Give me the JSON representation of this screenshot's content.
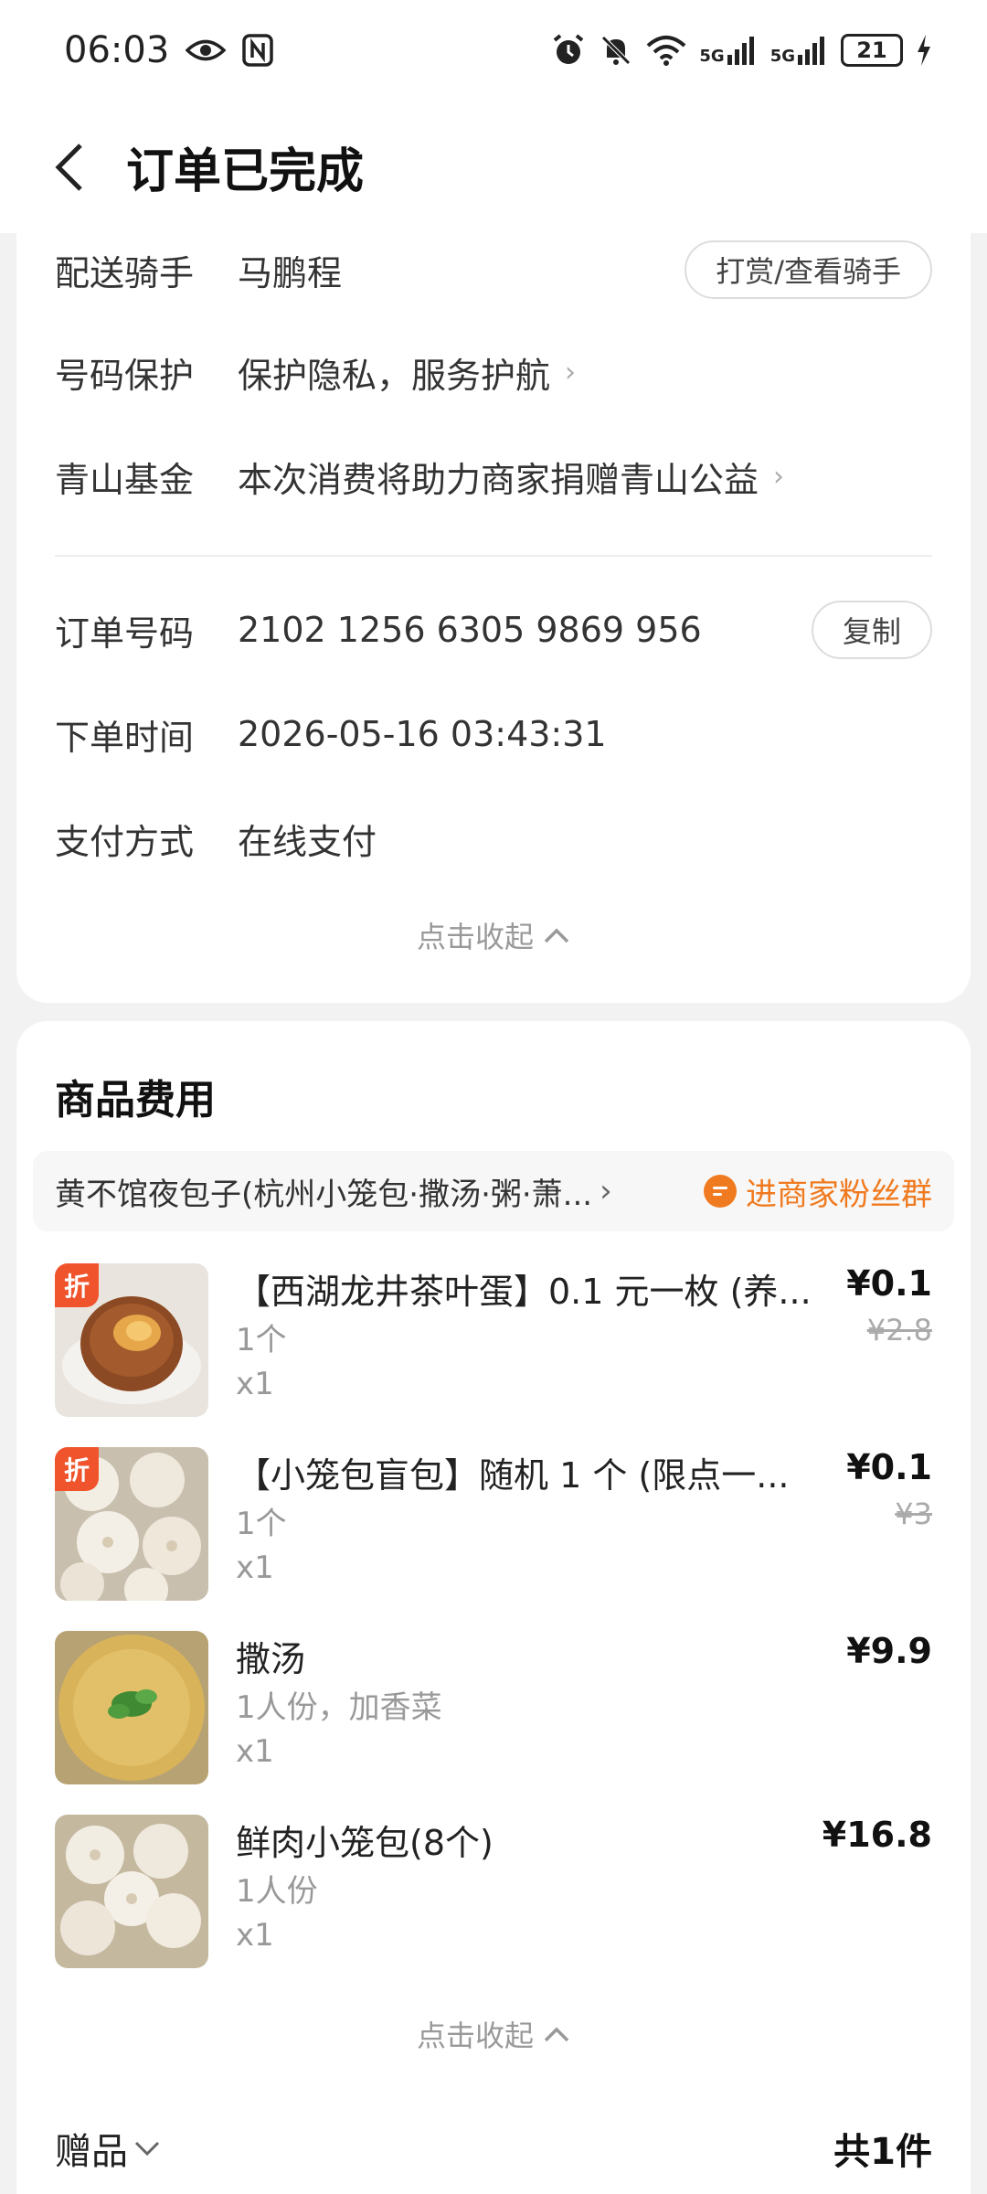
{
  "status_bar": {
    "time": "06:03",
    "battery": "21",
    "icons": [
      "eye-icon",
      "nfc-icon",
      "alarm-icon",
      "mute-icon",
      "wifi-icon",
      "signal-5g-icon",
      "signal-5g-icon",
      "battery-icon",
      "charging-icon"
    ],
    "net1": "5G",
    "net2": "5G"
  },
  "header": {
    "title": "订单已完成"
  },
  "order_info": {
    "rider_label": "配送骑手",
    "rider_name": "马鹏程",
    "rider_button": "打赏/查看骑手",
    "privacy_label": "号码保护",
    "privacy_value": "保护隐私，服务护航",
    "fund_label": "青山基金",
    "fund_value": "本次消费将助力商家捐赠青山公益",
    "order_no_label": "订单号码",
    "order_no": "2102 1256 6305 9869 956",
    "copy_button": "复制",
    "time_label": "下单时间",
    "time_value": "2026-05-16 03:43:31",
    "pay_label": "支付方式",
    "pay_value": "在线支付",
    "collapse": "点击收起"
  },
  "goods": {
    "title": "商品费用",
    "shop_name": "黄不馆夜包子(杭州小笼包·撒汤·粥·萧...",
    "fans_link": "进商家粉丝群",
    "items": [
      {
        "name": "【西湖龙井茶叶蛋】0.1 元一枚 (养...",
        "spec": "1个",
        "qty": "x1",
        "price": "¥0.1",
        "orig": "¥2.8",
        "badge": "折"
      },
      {
        "name": "【小笼包盲包】随机 1 个 (限点一...",
        "spec": "1个",
        "qty": "x1",
        "price": "¥0.1",
        "orig": "¥3",
        "badge": "折"
      },
      {
        "name": "撒汤",
        "spec": "1人份，加香菜",
        "qty": "x1",
        "price": "¥9.9",
        "orig": ""
      },
      {
        "name": "鲜肉小笼包(8个)",
        "spec": "1人份",
        "qty": "x1",
        "price": "¥16.8",
        "orig": ""
      }
    ],
    "collapse": "点击收起",
    "gift_label": "赠品",
    "total": "共1件"
  },
  "colors": {
    "accent_orange": "#f07a1f",
    "badge_red": "#f0542d"
  }
}
